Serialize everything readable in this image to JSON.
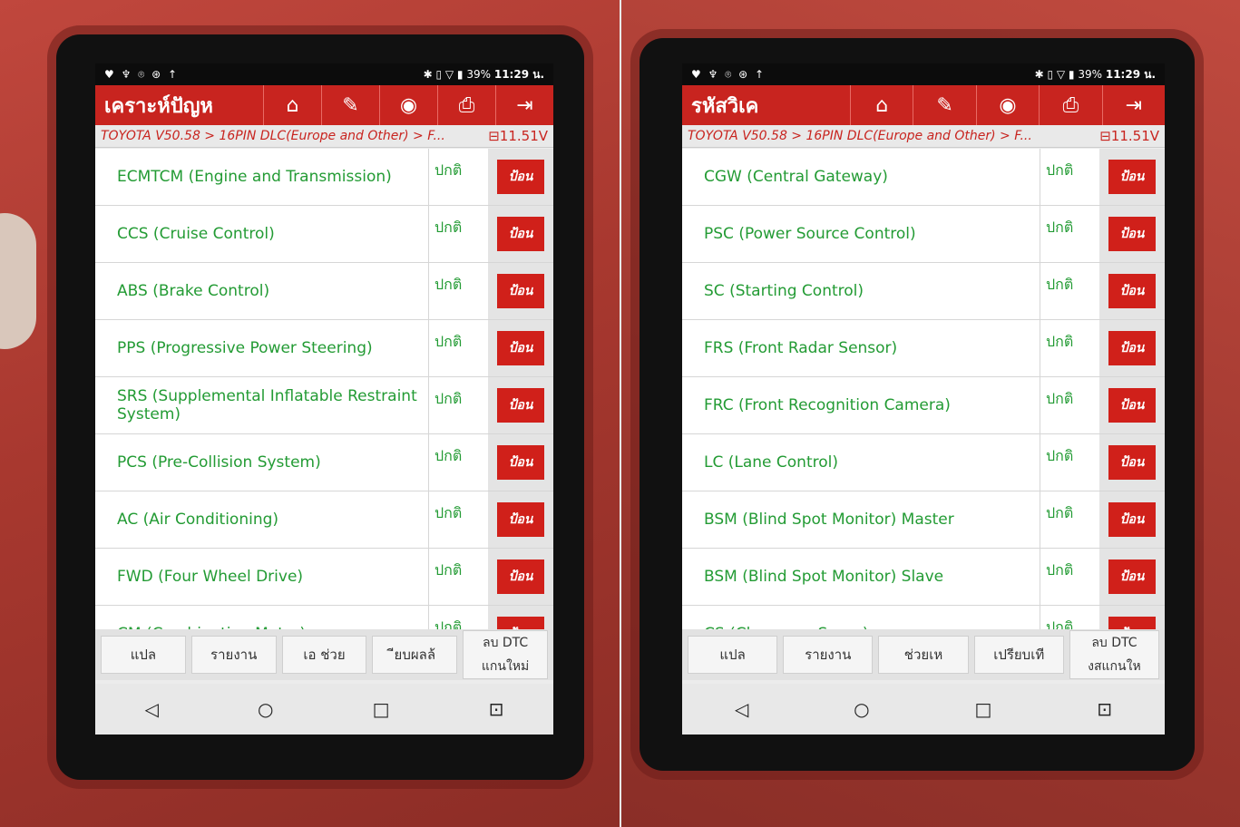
{
  "left": {
    "status_icons": "♥ ♆ ⌾ ⊛ ↑",
    "status_right": "✱ ▯ ▽ ▮",
    "battery": "39%",
    "time": "11:29 น.",
    "title": "เคราะห์ปัญห",
    "breadcrumb": "TOYOTA V50.58 > 16PIN DLC(Europe and Other) > F...",
    "voltage": "11.51V",
    "rows": [
      {
        "name": "ECMTCM (Engine and Transmission)",
        "status": "ปกติ",
        "action": "ป้อน"
      },
      {
        "name": "CCS (Cruise Control)",
        "status": "ปกติ",
        "action": "ป้อน"
      },
      {
        "name": "ABS (Brake Control)",
        "status": "ปกติ",
        "action": "ป้อน"
      },
      {
        "name": "PPS (Progressive Power Steering)",
        "status": "ปกติ",
        "action": "ป้อน"
      },
      {
        "name": "SRS (Supplemental Inflatable Restraint System)",
        "status": "ปกติ",
        "action": "ป้อน"
      },
      {
        "name": "PCS (Pre-Collision System)",
        "status": "ปกติ",
        "action": "ป้อน"
      },
      {
        "name": "AC (Air Conditioning)",
        "status": "ปกติ",
        "action": "ป้อน"
      },
      {
        "name": "FWD (Four Wheel Drive)",
        "status": "ปกติ",
        "action": "ป้อน"
      },
      {
        "name": "CM (Combination Meter)",
        "status": "ปกติ",
        "action": "ป้อน"
      }
    ],
    "actions": {
      "translate": "แปล",
      "report": "รายงาน",
      "help": "เอ ช่วย",
      "compare": "ียบผลล้",
      "clear_dtc": "ลบ DTC",
      "rescan": "แกนใหม่"
    }
  },
  "right": {
    "status_icons": "♥ ♆ ⌾ ⊛ ↑",
    "status_right": "✱ ▯ ▽ ▮",
    "battery": "39%",
    "time": "11:29 น.",
    "title": "รหัสวิเค",
    "breadcrumb": "TOYOTA V50.58 > 16PIN DLC(Europe and Other) > F...",
    "voltage": "11.51V",
    "rows": [
      {
        "name": "CGW (Central Gateway)",
        "status": "ปกติ",
        "action": "ป้อน"
      },
      {
        "name": "PSC (Power Source Control)",
        "status": "ปกติ",
        "action": "ป้อน"
      },
      {
        "name": "SC (Starting Control)",
        "status": "ปกติ",
        "action": "ป้อน"
      },
      {
        "name": "FRS (Front Radar Sensor)",
        "status": "ปกติ",
        "action": "ป้อน"
      },
      {
        "name": "FRC (Front Recognition Camera)",
        "status": "ปกติ",
        "action": "ป้อน"
      },
      {
        "name": "LC (Lane Control)",
        "status": "ปกติ",
        "action": "ป้อน"
      },
      {
        "name": "BSM (Blind Spot Monitor) Master",
        "status": "ปกติ",
        "action": "ป้อน"
      },
      {
        "name": "BSM (Blind Spot Monitor) Slave",
        "status": "ปกติ",
        "action": "ป้อน"
      },
      {
        "name": "CS (Clearance Sonar)",
        "status": "ปกติ",
        "action": "ป้อน"
      }
    ],
    "actions": {
      "translate": "แปล",
      "report": "รายงาน",
      "help": "ช่วยเห",
      "compare": "เปรียบเที",
      "clear_dtc": "ลบ DTC",
      "rescan": "งสแกนให"
    }
  },
  "nav": {
    "back": "◁",
    "home": "○",
    "recents": "□",
    "screenshot": "⊡"
  },
  "toolbar_icons": {
    "home": "⌂",
    "edit": "✎",
    "user": "◉",
    "print": "⎙",
    "exit": "⇥"
  },
  "colors": {
    "accent": "#c8241f",
    "ok_text": "#239b34",
    "button": "#d0201a"
  }
}
